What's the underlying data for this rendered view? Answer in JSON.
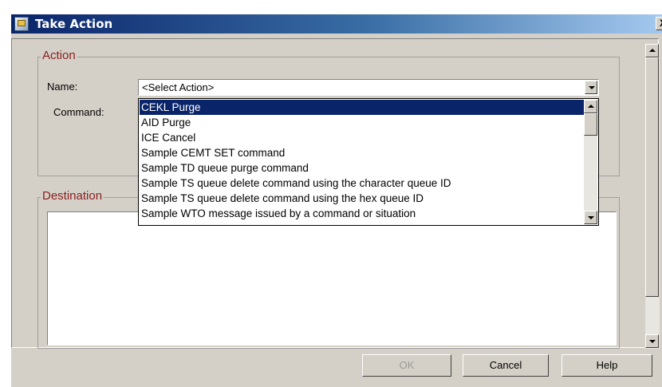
{
  "window": {
    "title": "Take Action",
    "close_glyph": "X"
  },
  "action_group": {
    "legend": "Action",
    "name_label": "Name:",
    "command_label": "Command:",
    "selected_action": "<Select Action>",
    "options": [
      "CEKL Purge",
      "AID Purge",
      "ICE Cancel",
      "Sample CEMT SET command",
      "Sample TD queue purge command",
      "Sample TS queue delete command using the character queue ID",
      "Sample TS queue delete command using the hex queue ID",
      "Sample WTO message issued by a command or situation"
    ],
    "highlighted_index": 0
  },
  "destination_group": {
    "legend": "Destination"
  },
  "buttons": {
    "ok": "OK",
    "cancel": "Cancel",
    "help": "Help"
  },
  "icons": {
    "title": "take-action-icon",
    "close": "close-icon",
    "dropdown": "chevron-down-icon",
    "scroll_up": "scroll-up-arrow-icon",
    "scroll_down": "scroll-down-arrow-icon"
  },
  "colors": {
    "title_bar": "#0a246a",
    "selection": "#0a246a",
    "legend_text": "#8b2020",
    "dialog_bg": "#d4d0c8"
  }
}
